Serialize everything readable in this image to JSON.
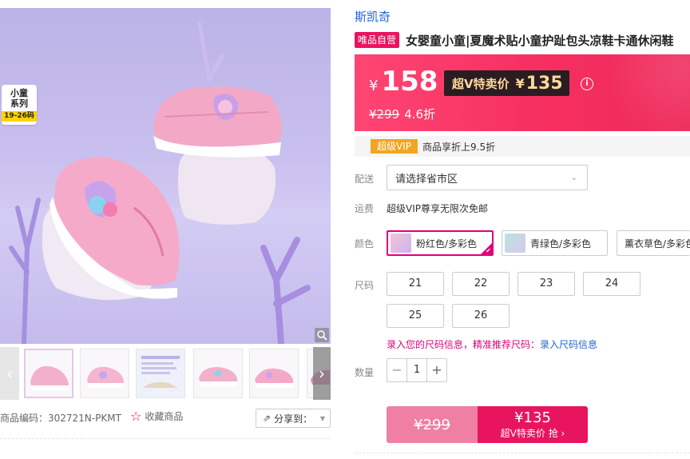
{
  "gallery": {
    "series_tag": {
      "line1": "小童",
      "line2": "系列",
      "line3": "19-26码"
    },
    "zoom_icon": "magnifier-icon",
    "prev_arrow": "‹",
    "next_arrow": "›"
  },
  "product": {
    "sku_label": "商品编码：302721N-PKMT",
    "favorite_label": "收藏商品",
    "share_label": "分享到：",
    "brand": "斯凯奇",
    "self_operated_badge": "唯品自营",
    "title": "女婴童小童|夏魔术贴小童护趾包头凉鞋卡通休闲鞋"
  },
  "price": {
    "currency": "¥",
    "current": "158",
    "vip_label": "超V特卖价",
    "vip_currency": "¥",
    "vip_price": "135",
    "original": "¥299",
    "discount": "4.6折",
    "info_icon": "i"
  },
  "vip_bar": {
    "badge": "超级VIP",
    "text": "商品享折上9.5折"
  },
  "delivery": {
    "label": "配送",
    "placeholder": "请选择省市区"
  },
  "shipping": {
    "label": "运费",
    "text": "超级VIP尊享无限次免邮"
  },
  "colors": {
    "label": "颜色",
    "options": [
      "粉红色/多彩色",
      "青绿色/多彩色",
      "薰衣草色/多彩色"
    ],
    "selected": "粉红色/多彩色"
  },
  "sizes": {
    "label": "尺码",
    "options": [
      "21",
      "22",
      "23",
      "24",
      "25",
      "26"
    ],
    "hint_text": "录入您的尺码信息，精准推荐尺码：",
    "hint_link": "录入尺码信息"
  },
  "quantity": {
    "label": "数量",
    "minus": "−",
    "value": "1",
    "plus": "+"
  },
  "buy": {
    "original_price": "¥299",
    "vip_price": "¥135",
    "vip_label": "超V特卖价 抢 ›"
  },
  "colors_theme": {
    "accent": "#e8155e",
    "brand_link": "#2463d6",
    "vip_gold": "#ffd89a"
  }
}
